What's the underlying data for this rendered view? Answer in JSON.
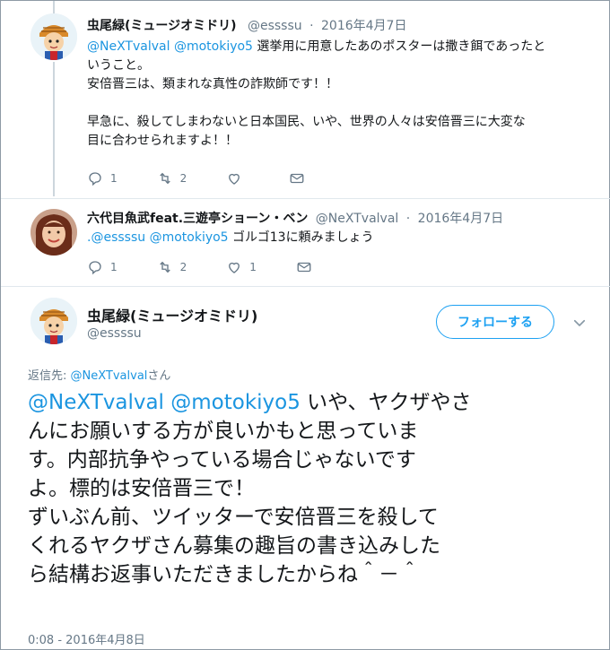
{
  "tweet1": {
    "name": "虫尾緑(ミュージオミドリ)",
    "handle": "@essssu",
    "separator": "·",
    "date": "2016年4月7日",
    "mention1": "@NeXTvalval",
    "mention2": "@motokiyo5",
    "text_line1": "選挙用に用意したあのポスターは撒き餌であったと",
    "text_line2": "いうこと。",
    "text_line3": "安倍晋三は、類まれな真性の詐欺師です！！",
    "text_line4": "早急に、殺してしまわないと日本国民、いや、世界の人々は安倍晋三に大変な",
    "text_line5": "目に合わせられますよ！！",
    "reply_count": "1",
    "retweet_count": "2",
    "like_count": ""
  },
  "tweet2": {
    "name": "六代目魚武feat.三遊亭ショーン・ベン",
    "handle": "@NeXTvalval",
    "separator": "·",
    "date": "2016年4月7日",
    "mention1": ".@essssu",
    "mention2": "@motokiyo5",
    "text": "ゴルゴ13に頼みましょう",
    "reply_count": "1",
    "retweet_count": "2",
    "like_count": "1"
  },
  "main_tweet": {
    "name": "虫尾緑(ミュージオミドリ)",
    "handle": "@essssu",
    "follow_label": "フォローする",
    "reply_to_prefix": "返信先: ",
    "reply_to_handle": "@NeXTvalval",
    "reply_to_suffix": "さん",
    "mentions": "@NeXTvalval @motokiyo5",
    "line1_rest": " いや、ヤクザやさ",
    "line2": "んにお願いする方が良いかもと思っていま",
    "line3": "す。内部抗争やっている場合じゃないです",
    "line4": "よ。標的は安倍晋三で！",
    "line5": "ずいぶん前、ツイッターで安倍晋三を殺して",
    "line6": "くれるヤクザさん募集の趣旨の書き込みした",
    "line7": "ら結構お返事いただきましたからね＾－＾",
    "timestamp": "0:08 - 2016年4月8日"
  },
  "colors": {
    "link": "#1b95e0",
    "follow": "#1da1f2",
    "muted": "#657786"
  }
}
